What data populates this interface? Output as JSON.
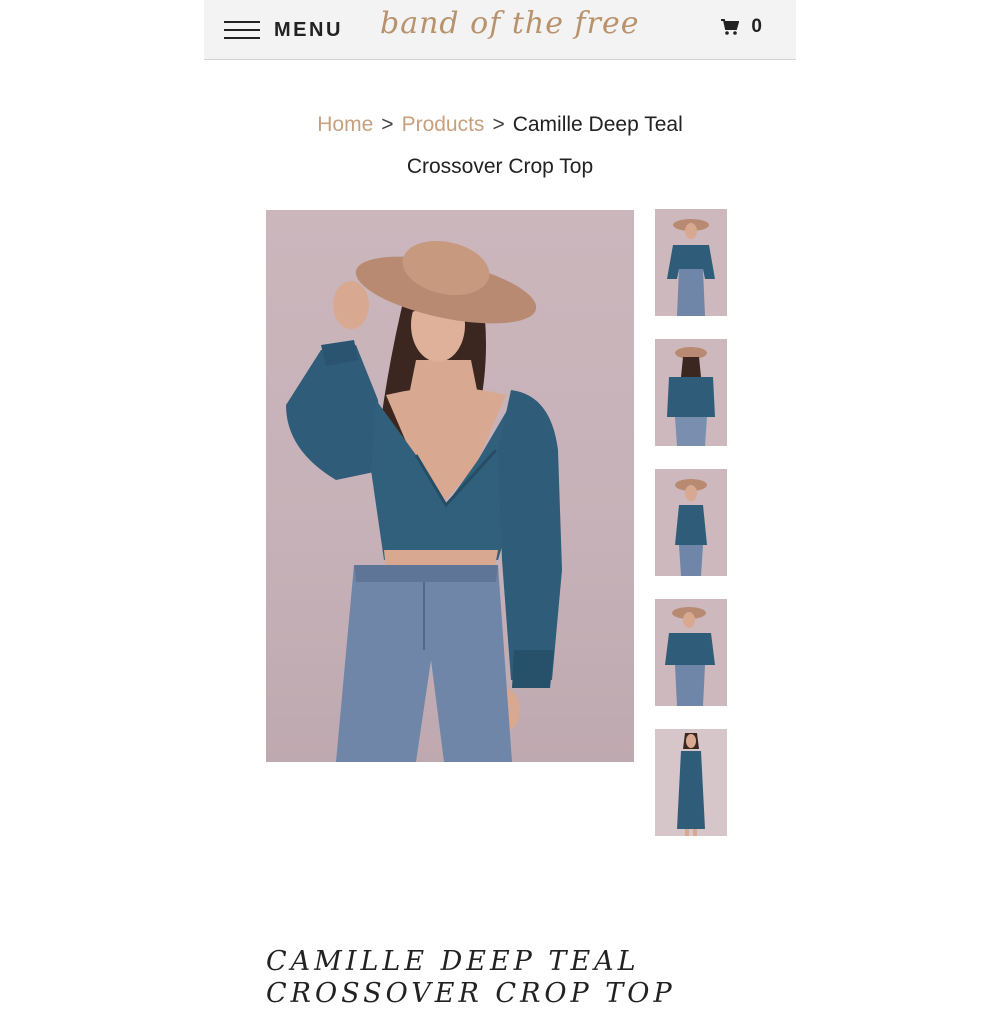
{
  "header": {
    "menu_label": "MENU",
    "logo_text": "band of the free",
    "cart_count": "0"
  },
  "breadcrumb": {
    "home": "Home",
    "products": "Products",
    "separator": ">",
    "current_line1": "Camille Deep Teal",
    "current_line2": "Crossover Crop Top"
  },
  "product": {
    "title_line1": "CAMILLE DEEP TEAL",
    "title_line2": "CROSSOVER CROP TOP",
    "thumbnails": [
      "front-hat",
      "back-view",
      "side-view",
      "front-full",
      "dress-full"
    ]
  },
  "colors": {
    "accent": "#c7a07e",
    "logo": "#b8926c",
    "teal": "#2f5c78",
    "denim": "#6f86a8",
    "background": "#c8b4ba"
  }
}
